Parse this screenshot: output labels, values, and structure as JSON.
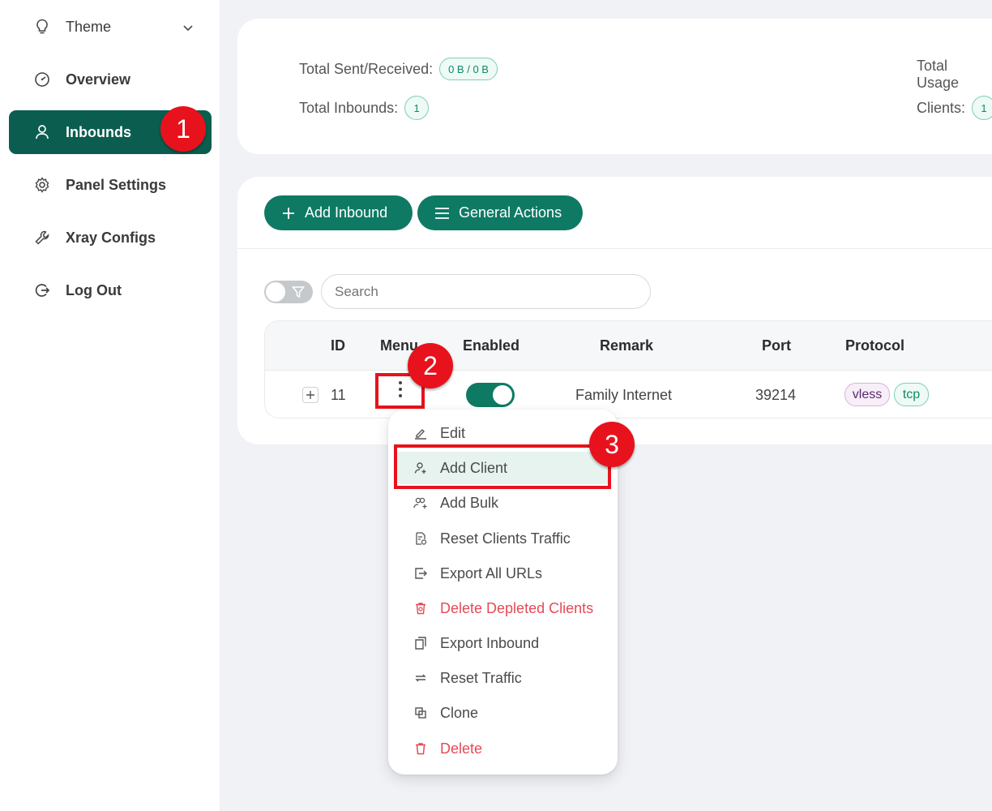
{
  "sidebar": {
    "theme": "Theme",
    "items": [
      {
        "label": "Overview"
      },
      {
        "label": "Inbounds"
      },
      {
        "label": "Panel Settings"
      },
      {
        "label": "Xray Configs"
      },
      {
        "label": "Log Out"
      }
    ]
  },
  "stats": {
    "sent_received_label": "Total Sent/Received:",
    "sent_received_value": "0 B / 0 B",
    "total_usage_label": "Total Usage",
    "total_inbounds_label": "Total Inbounds:",
    "total_inbounds_value": "1",
    "clients_label": "Clients:",
    "clients_value": "1"
  },
  "toolbar": {
    "add_inbound": "Add Inbound",
    "general_actions": "General Actions"
  },
  "search": {
    "placeholder": "Search"
  },
  "table": {
    "headers": {
      "id": "ID",
      "menu": "Menu",
      "enabled": "Enabled",
      "remark": "Remark",
      "port": "Port",
      "protocol": "Protocol"
    },
    "row": {
      "id": "11",
      "enabled": true,
      "remark": "Family Internet",
      "port": "39214",
      "protocol": "vless",
      "transport": "tcp"
    }
  },
  "menu": {
    "items": [
      {
        "label": "Edit",
        "danger": false
      },
      {
        "label": "Add Client",
        "danger": false
      },
      {
        "label": "Add Bulk",
        "danger": false
      },
      {
        "label": "Reset Clients Traffic",
        "danger": false
      },
      {
        "label": "Export All URLs",
        "danger": false
      },
      {
        "label": "Delete Depleted Clients",
        "danger": true
      },
      {
        "label": "Export Inbound",
        "danger": false
      },
      {
        "label": "Reset Traffic",
        "danger": false
      },
      {
        "label": "Clone",
        "danger": false
      },
      {
        "label": "Delete",
        "danger": true
      }
    ]
  },
  "annotations": {
    "step1": "1",
    "step2": "2",
    "step3": "3"
  },
  "colors": {
    "primary": "#0e7a64",
    "sidebar_active": "#0b5e4f",
    "annotation": "#e8121c",
    "danger": "#e64a55"
  }
}
